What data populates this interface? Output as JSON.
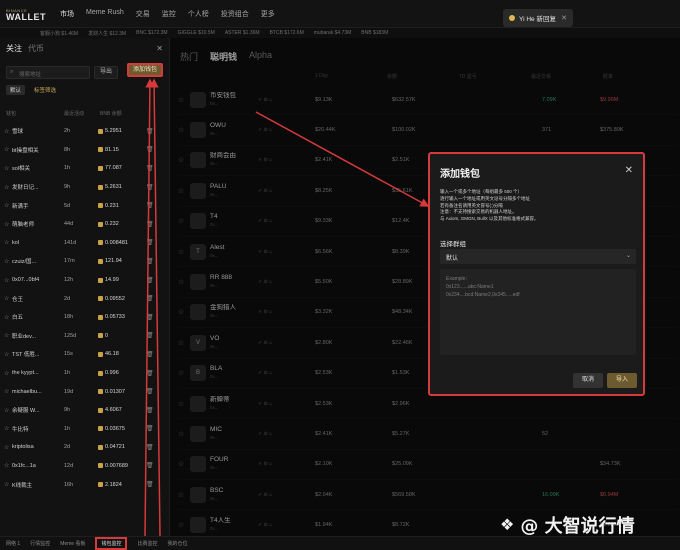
{
  "topbar": {
    "logo_top": "BINANCE",
    "logo_main": "WALLET",
    "nav": [
      "市场",
      "Meme Rush",
      "交易",
      "监控",
      "个人榜",
      "投资组合",
      "更多"
    ],
    "user_pill": "Yi He 新回复"
  },
  "ticker": [
    "客服小狗 $1.46M",
    "发财人生 $12.3M",
    "BNC $172.3M",
    "GIGGLE $10.5M",
    "ASTER $1.36M",
    "BTCB $172.6M",
    "mubarak $4.73M",
    "BNB $183M"
  ],
  "left": {
    "tab_follow": "关注",
    "tab_coin": "代币",
    "search_placeholder": "搜索地址",
    "export_label": "导出",
    "add_wallet_label": "添加钱包",
    "filter_default": "默认",
    "filter_other": "标签筛选",
    "cols": [
      "钱包",
      "最近活动",
      "BNB 余额"
    ],
    "rows": [
      {
        "name": "雪球",
        "age": "2h",
        "val": "5.2951"
      },
      {
        "name": "bt操盘相关",
        "age": "8h",
        "val": "81.15"
      },
      {
        "name": "sol相关",
        "age": "1h",
        "val": "77.087"
      },
      {
        "name": "发财日记...",
        "age": "9h",
        "val": "5.2631"
      },
      {
        "name": "新满手",
        "age": "5d",
        "val": "0.231"
      },
      {
        "name": "萌脑老师",
        "age": "44d",
        "val": "0.232"
      },
      {
        "name": "kol",
        "age": "141d",
        "val": "0.008481"
      },
      {
        "name": "czuiz/国...",
        "age": "17m",
        "val": "121.94"
      },
      {
        "name": "0x07...0bf4",
        "age": "12h",
        "val": "14.99"
      },
      {
        "name": "仓王",
        "age": "2d",
        "val": "0.09552"
      },
      {
        "name": "白五",
        "age": "18h",
        "val": "0.05733"
      },
      {
        "name": "职业dev...",
        "age": "125d",
        "val": "0"
      },
      {
        "name": "TST 低胜...",
        "age": "15s",
        "val": "46.18"
      },
      {
        "name": "the kyypt...",
        "age": "1h",
        "val": "0.996"
      },
      {
        "name": "michaelbu...",
        "age": "19d",
        "val": "0.01307"
      },
      {
        "name": "余疑服 W...",
        "age": "9h",
        "val": "4.6067"
      },
      {
        "name": "牛比特",
        "age": "1h",
        "val": "0.03675"
      },
      {
        "name": "kriptolisa",
        "age": "2d",
        "val": "0.04721"
      },
      {
        "name": "0x1fc...1a",
        "age": "12d",
        "val": "0.007689"
      },
      {
        "name": "K线裁主",
        "age": "16h",
        "val": "2.1824"
      }
    ]
  },
  "main": {
    "tabs": [
      "热门",
      "聪明钱",
      "Alpha"
    ],
    "cols": [
      "1 Day",
      "余额",
      "7D 盈亏",
      "最近交易",
      "胜率"
    ],
    "rows": [
      {
        "avatar": "",
        "name": "币安钱包",
        "sub": "0x...",
        "c1": "$9.13K",
        "c2": "$632.57K",
        "c3": "7.09K",
        "c4": "$9.96M",
        "c3c": "g",
        "c4c": "r"
      },
      {
        "avatar": "",
        "name": "OWU",
        "sub": "0x...",
        "c1": "$20.44K",
        "c2": "$100.02K",
        "c3": "371",
        "c4": "$375.80K",
        "c3c": "",
        "c4c": ""
      },
      {
        "avatar": "",
        "name": "财商会由",
        "sub": "0x...",
        "c1": "$2.41K",
        "c2": "$2.51K",
        "c3": "1270",
        "c4": "$1.29M",
        "c3c": "",
        "c4c": ""
      },
      {
        "avatar": "",
        "name": "PALU",
        "sub": "0x...",
        "c1": "$8.25K",
        "c2": "$35.61K",
        "c3": "",
        "c4": "",
        "c3c": "",
        "c4c": ""
      },
      {
        "avatar": "",
        "name": "T4",
        "sub": "0x...",
        "c1": "$9.33K",
        "c2": "$12.4K",
        "c3": "",
        "c4": "",
        "c3c": "",
        "c4c": ""
      },
      {
        "avatar": "T",
        "name": "Alest",
        "sub": "0x...",
        "c1": "$6.56K",
        "c2": "$8.39K",
        "c3": "",
        "c4": "",
        "c3c": "",
        "c4c": ""
      },
      {
        "avatar": "",
        "name": "RR 888",
        "sub": "0x...",
        "c1": "$5.50K",
        "c2": "$28.89K",
        "c3": "",
        "c4": "",
        "c3c": "",
        "c4c": ""
      },
      {
        "avatar": "",
        "name": "金狗猎人",
        "sub": "0x...",
        "c1": "$3.32K",
        "c2": "$48.34K",
        "c3": "",
        "c4": "",
        "c3c": "",
        "c4c": ""
      },
      {
        "avatar": "V",
        "name": "VO",
        "sub": "0x...",
        "c1": "$2.80K",
        "c2": "$22.46K",
        "c3": "",
        "c4": "",
        "c3c": "",
        "c4c": ""
      },
      {
        "avatar": "B",
        "name": "BLA",
        "sub": "0x...",
        "c1": "$2.53K",
        "c2": "$1.53K",
        "c3": "",
        "c4": "",
        "c3c": "",
        "c4c": ""
      },
      {
        "avatar": "",
        "name": "新蝉蒂",
        "sub": "0x...",
        "c1": "$2.53K",
        "c2": "$2.96K",
        "c3": "",
        "c4": "",
        "c3c": "",
        "c4c": ""
      },
      {
        "avatar": "",
        "name": "MIC",
        "sub": "0x...",
        "c1": "$2.41K",
        "c2": "$5.27K",
        "c3": "52",
        "c4": "",
        "c3c": "",
        "c4c": ""
      },
      {
        "avatar": "",
        "name": "FOUR",
        "sub": "0x...",
        "c1": "$2.10K",
        "c2": "$25.09K",
        "c3": "",
        "c4": "$34.73K",
        "c3c": "",
        "c4c": ""
      },
      {
        "avatar": "",
        "name": "BSC",
        "sub": "0x...",
        "c1": "$2.04K",
        "c2": "$569.58K",
        "c3": "16.09K",
        "c4": "$6.94M",
        "c3c": "g",
        "c4c": "r"
      },
      {
        "avatar": "",
        "name": "T4人生",
        "sub": "0x...",
        "c1": "$1.94K",
        "c2": "$8.72K",
        "c3": "",
        "c4": "$1.02M",
        "c3c": "",
        "c4c": ""
      }
    ]
  },
  "modal": {
    "title": "添加钱包",
    "desc_lines": [
      "输入一个或多个地址（每组最多 500 个）",
      "逐行输入一个地址或用英文逗号分隔多个地址",
      "若有备注名请用英文冒号(:)分隔",
      "注意：不支持搜索交易的机器人地址。",
      "与 Axiom, GMGN, BullX 以及其他标准格式兼容。"
    ],
    "group_label": "选择群组",
    "group_value": "默认",
    "example_lines": [
      "Example:",
      "0x123......abc:Name1",
      "0x234....bcd:Name2,0x345.....edf"
    ],
    "cancel_label": "取消",
    "import_label": "导入"
  },
  "bottombar": [
    "网络 1",
    "行情监控",
    "Meme 看板",
    "钱包监控",
    "比赛监控",
    "我的仓位"
  ],
  "watermark": "@ 大智说行情",
  "colors": {
    "accent_gold": "#6e5a2f",
    "highlight_red": "#d63a3a",
    "up_green": "#3fb27f",
    "down_red": "#e0555c"
  }
}
